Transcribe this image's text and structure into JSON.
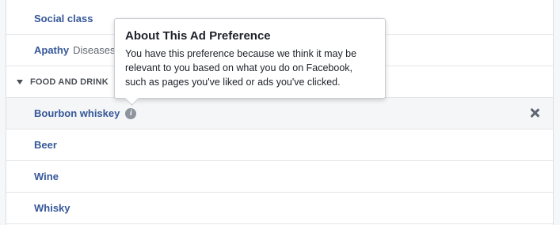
{
  "rows": {
    "social_class": {
      "label": "Social class"
    },
    "apathy": {
      "label": "Apathy",
      "sub": "Diseases"
    },
    "food_and_drink": {
      "label": "FOOD AND DRINK"
    },
    "bourbon_whiskey": {
      "label": "Bourbon whiskey",
      "info_icon": "info-icon",
      "remove_icon": "close-icon"
    },
    "beer": {
      "label": "Beer"
    },
    "wine": {
      "label": "Wine"
    },
    "whisky": {
      "label": "Whisky"
    }
  },
  "tooltip": {
    "title": "About This Ad Preference",
    "body": "You have this preference because we think it may be relevant to you based on what you do on Facebook, such as pages you've liked or ads you've clicked."
  },
  "colors": {
    "link": "#365899",
    "muted": "#616770",
    "border": "#dddfe2",
    "row_highlight": "#f5f6f7"
  }
}
